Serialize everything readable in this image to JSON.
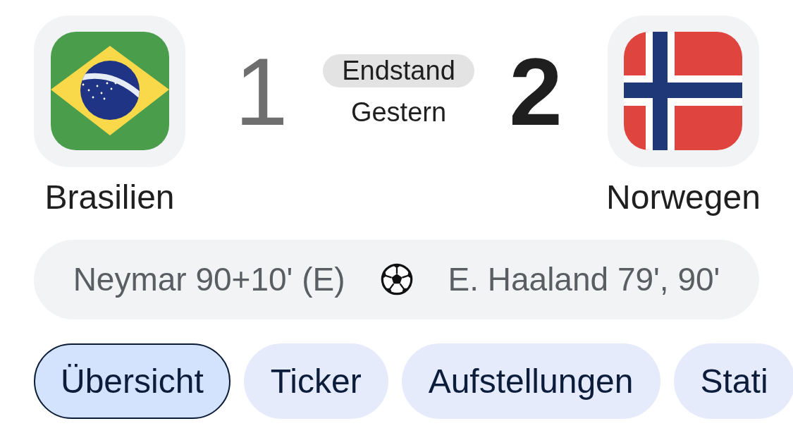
{
  "match": {
    "teams": [
      {
        "name": "Brasilien",
        "score": "1",
        "winner": false
      },
      {
        "name": "Norwegen",
        "score": "2",
        "winner": true
      }
    ],
    "status": "Endstand",
    "date": "Gestern"
  },
  "scorers": {
    "home": "Neymar 90+10' (E)",
    "away": "E. Haaland 79', 90'"
  },
  "tabs": [
    {
      "label": "Übersicht",
      "selected": true
    },
    {
      "label": "Ticker",
      "selected": false
    },
    {
      "label": "Aufstellungen",
      "selected": false
    },
    {
      "label": "Stati",
      "selected": false
    }
  ]
}
